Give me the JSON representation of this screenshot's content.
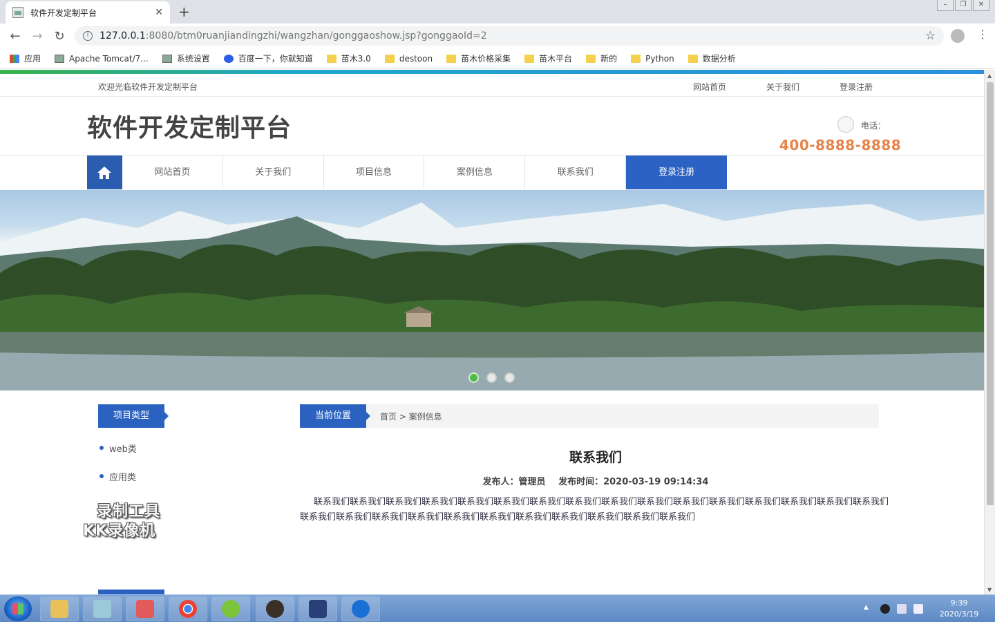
{
  "browser": {
    "tab_title": "软件开发定制平台",
    "url_host": "127.0.0.1",
    "url_path": ":8080/btm0ruanjiandingzhi/wangzhan/gonggaoshow.jsp?gonggaoId=2",
    "bookmarks": [
      {
        "label": "应用",
        "icon": "apps-icon"
      },
      {
        "label": "Apache Tomcat/7...",
        "icon": "page-icon"
      },
      {
        "label": "系统设置",
        "icon": "page-icon"
      },
      {
        "label": "百度一下，你就知道",
        "icon": "baidu-paw-icon"
      },
      {
        "label": "苗木3.0",
        "icon": "folder-icon"
      },
      {
        "label": "destoon",
        "icon": "folder-icon"
      },
      {
        "label": "苗木价格采集",
        "icon": "folder-icon"
      },
      {
        "label": "苗木平台",
        "icon": "folder-icon"
      },
      {
        "label": "新的",
        "icon": "folder-icon"
      },
      {
        "label": "Python",
        "icon": "folder-icon"
      },
      {
        "label": "数据分析",
        "icon": "folder-icon"
      }
    ]
  },
  "site": {
    "welcome": "欢迎光临软件开发定制平台",
    "top_links": [
      "网站首页",
      "关于我们",
      "登录注册"
    ],
    "title": "软件开发定制平台",
    "phone_label": "电话：",
    "phone_number": "400-8888-8888",
    "nav": [
      "网站首页",
      "关于我们",
      "项目信息",
      "案例信息",
      "联系我们",
      "登录注册"
    ],
    "nav_active_index": 5,
    "banner_slide_count": 3,
    "banner_active_index": 0
  },
  "sidebar": {
    "title": "项目类型",
    "items": [
      "web类",
      "应用类"
    ]
  },
  "breadcrumb": {
    "label": "当前位置",
    "path": "首页 > 案例信息"
  },
  "article": {
    "title": "联系我们",
    "publisher": "发布人：管理员",
    "publish_time": "发布时间：2020-03-19 09:14:34",
    "body": "联系我们联系我们联系我们联系我们联系我们联系我们联系我们联系我们联系我们联系我们联系我们联系我们联系我们联系我们联系我们联系我们联系我们联系我们联系我们联系我们联系我们联系我们联系我们联系我们联系我们联系我们联系我们"
  },
  "watermark": {
    "line1": "录制工具",
    "line2": "KK录像机"
  },
  "taskbar": {
    "time": "9:39",
    "date": "2020/3/19"
  },
  "colors": {
    "primary_blue": "#2b62c0",
    "phone_orange": "#e8834a",
    "banner_dot_active": "#52b848"
  }
}
